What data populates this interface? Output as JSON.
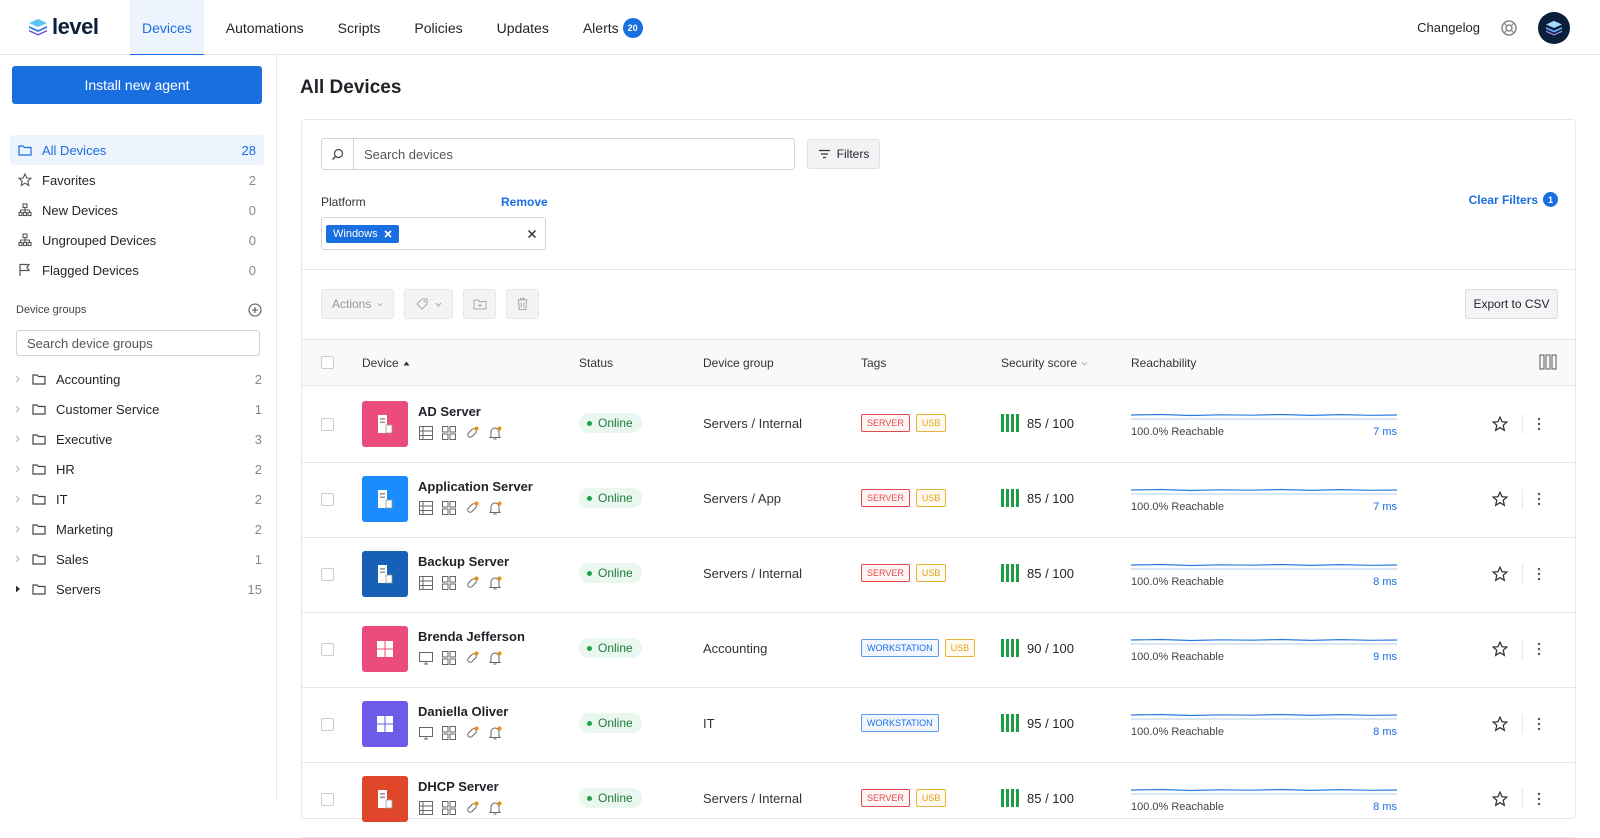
{
  "app": {
    "logo_text": "level"
  },
  "nav": {
    "tabs": [
      {
        "label": "Devices"
      },
      {
        "label": "Automations"
      },
      {
        "label": "Scripts"
      },
      {
        "label": "Policies"
      },
      {
        "label": "Updates"
      },
      {
        "label": "Alerts"
      }
    ],
    "alerts_count": "20",
    "changelog": "Changelog"
  },
  "sidebar": {
    "install_label": "Install new agent",
    "items": [
      {
        "label": "All Devices",
        "count": "28"
      },
      {
        "label": "Favorites",
        "count": "2"
      },
      {
        "label": "New Devices",
        "count": "0"
      },
      {
        "label": "Ungrouped Devices",
        "count": "0"
      },
      {
        "label": "Flagged Devices",
        "count": "0"
      }
    ],
    "groups_title": "Device groups",
    "groups_search_placeholder": "Search device groups",
    "groups": [
      {
        "label": "Accounting",
        "count": "2"
      },
      {
        "label": "Customer Service",
        "count": "1"
      },
      {
        "label": "Executive",
        "count": "3"
      },
      {
        "label": "HR",
        "count": "2"
      },
      {
        "label": "IT",
        "count": "2"
      },
      {
        "label": "Marketing",
        "count": "2"
      },
      {
        "label": "Sales",
        "count": "1"
      },
      {
        "label": "Servers",
        "count": "15"
      }
    ]
  },
  "main": {
    "title": "All Devices",
    "search_placeholder": "Search devices",
    "filters_label": "Filters",
    "platform_label": "Platform",
    "remove_label": "Remove",
    "platform_chip": "Windows",
    "clear_filters": "Clear Filters",
    "clear_count": "1",
    "actions_label": "Actions",
    "export_label": "Export to CSV",
    "columns": {
      "device": "Device",
      "status": "Status",
      "group": "Device group",
      "tags": "Tags",
      "score": "Security score",
      "reach": "Reachability"
    },
    "rows": [
      {
        "name": "AD Server",
        "status": "Online",
        "group": "Servers / Internal",
        "tags": [
          "SERVER",
          "USB"
        ],
        "score": "85 / 100",
        "reach": "100.0% Reachable",
        "ms": "7 ms",
        "icon": "server",
        "color": "#ec4c7c"
      },
      {
        "name": "Application Server",
        "status": "Online",
        "group": "Servers / App",
        "tags": [
          "SERVER",
          "USB"
        ],
        "score": "85 / 100",
        "reach": "100.0% Reachable",
        "ms": "7 ms",
        "icon": "server",
        "color": "#1a8cff"
      },
      {
        "name": "Backup Server",
        "status": "Online",
        "group": "Servers / Internal",
        "tags": [
          "SERVER",
          "USB"
        ],
        "score": "85 / 100",
        "reach": "100.0% Reachable",
        "ms": "8 ms",
        "icon": "server",
        "color": "#1660b8"
      },
      {
        "name": "Brenda Jefferson",
        "status": "Online",
        "group": "Accounting",
        "tags": [
          "WORKSTATION",
          "USB"
        ],
        "score": "90 / 100",
        "reach": "100.0% Reachable",
        "ms": "9 ms",
        "icon": "windows",
        "color": "#ec4c7c"
      },
      {
        "name": "Daniella Oliver",
        "status": "Online",
        "group": "IT",
        "tags": [
          "WORKSTATION"
        ],
        "score": "95 / 100",
        "reach": "100.0% Reachable",
        "ms": "8 ms",
        "icon": "windows",
        "color": "#6b5be6"
      },
      {
        "name": "DHCP Server",
        "status": "Online",
        "group": "Servers / Internal",
        "tags": [
          "SERVER",
          "USB"
        ],
        "score": "85 / 100",
        "reach": "100.0% Reachable",
        "ms": "8 ms",
        "icon": "server",
        "color": "#e0462a"
      }
    ]
  }
}
